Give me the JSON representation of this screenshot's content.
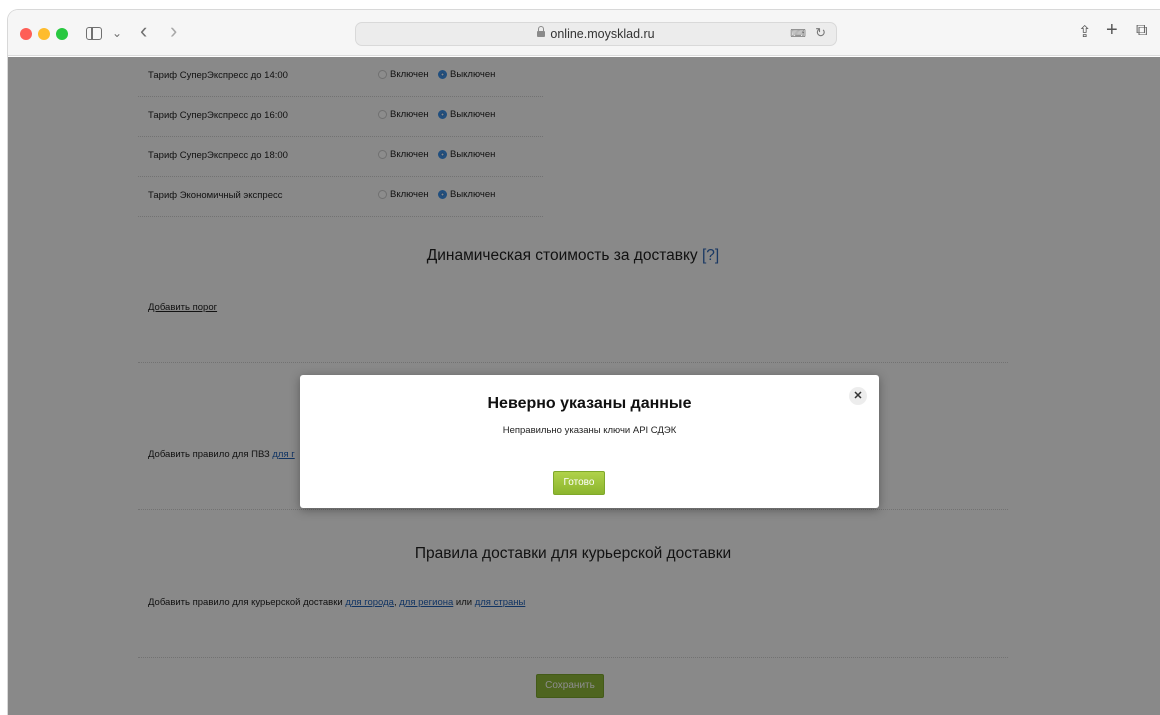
{
  "browser": {
    "url": "online.moysklad.ru",
    "back_glyph": "‹",
    "forward_glyph": "›",
    "chevron_glyph": "⌄",
    "share_glyph": "⇪",
    "plus_glyph": "+",
    "tabs_glyph": "⧉",
    "translate_glyph": "⌨",
    "reload_glyph": "↻",
    "icons": [
      "sidebar-icon",
      "chevron-down-icon",
      "back-icon",
      "forward-icon",
      "lock-icon",
      "translate-icon",
      "reload-icon",
      "share-icon",
      "new-tab-icon",
      "tabs-overview-icon"
    ]
  },
  "tariffs": [
    {
      "name": "Тариф СуперЭкспресс до 14:00",
      "on_label": "Включен",
      "off_label": "Выключен",
      "selected": "off"
    },
    {
      "name": "Тариф СуперЭкспресс до 16:00",
      "on_label": "Включен",
      "off_label": "Выключен",
      "selected": "off"
    },
    {
      "name": "Тариф СуперЭкспресс до 18:00",
      "on_label": "Включен",
      "off_label": "Выключен",
      "selected": "off"
    },
    {
      "name": "Тариф Экономичный экспресс",
      "on_label": "Включен",
      "off_label": "Выключен",
      "selected": "off"
    }
  ],
  "dynamic": {
    "title": "Динамическая стоимость за доставку",
    "help": "[?]",
    "add_threshold": "Добавить порог"
  },
  "pvz": {
    "prefix": "Добавить правило для ПВЗ",
    "link_partial": "для г"
  },
  "courier": {
    "title": "Правила доставки для курьерской доставки",
    "prefix": "Добавить правило для курьерской доставки",
    "city": "для города",
    "comma": ",",
    "region": "для региона",
    "or": "или",
    "country": "для страны"
  },
  "save_label": "Сохранить",
  "modal": {
    "title": "Неверно указаны данные",
    "message": "Неправильно указаны ключи API СДЭК",
    "ok_label": "Готово",
    "close_glyph": "✕"
  },
  "colors": {
    "accent_green": "#8fb93a",
    "radio_blue": "#3b8ee6",
    "link_blue": "#1f5fb4"
  }
}
